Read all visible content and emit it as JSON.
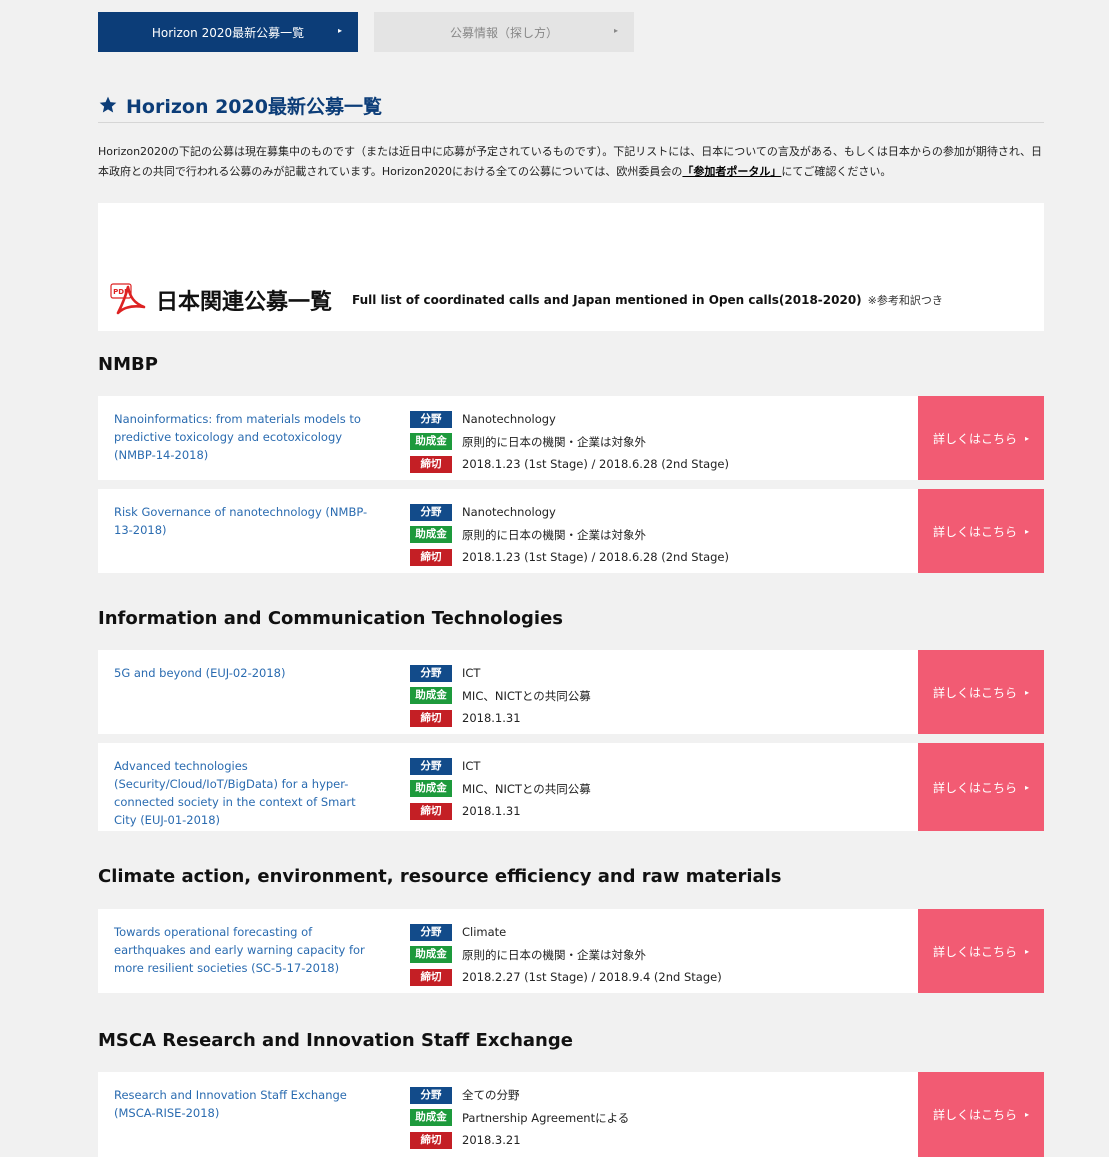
{
  "tabs": [
    {
      "label": "Horizon 2020最新公募一覧",
      "arrow": "▸"
    },
    {
      "label": "公募情報（探し方）",
      "arrow": "▸"
    }
  ],
  "page": {
    "title": "Horizon 2020最新公募一覧",
    "intro_pre": "Horizon2020の下記の公募は現在募集中のものです（または近日中に応募が予定されているものです）。下記リストには、日本についての言及がある、もしくは日本からの参加が期待され、日本政府との共同で行われる公募のみが記載されています。Horizon2020における全ての公募については、欧州委員会の",
    "intro_link": "「参加者ポータル」",
    "intro_post": "にてご確認ください。"
  },
  "pdf": {
    "title": "日本関連公募一覧",
    "subtitle": "Full list of coordinated calls and Japan mentioned in Open calls(2018-2020)",
    "note": "※参考和訳つき"
  },
  "labels": {
    "field": "分野",
    "grant": "助成金",
    "deadline": "締切",
    "detail": "詳しくはこちら",
    "detail_arrow": "▸"
  },
  "sections": [
    {
      "title": "NMBP",
      "calls": [
        {
          "title": "Nanoinformatics: from materials models to predictive toxicology and ecotoxicology (NMBP-14-2018)",
          "field": "Nanotechnology",
          "grant": "原則的に日本の機関・企業は対象外",
          "deadline": "2018.1.23 (1st Stage) / 2018.6.28 (2nd Stage)"
        },
        {
          "title": "Risk Governance of nanotechnology (NMBP-13-2018)",
          "field": "Nanotechnology",
          "grant": "原則的に日本の機関・企業は対象外",
          "deadline": "2018.1.23 (1st Stage) / 2018.6.28 (2nd Stage)"
        }
      ]
    },
    {
      "title": "Information and Communication Technologies",
      "calls": [
        {
          "title": "5G and beyond (EUJ-02-2018)",
          "field": "ICT",
          "grant": "MIC、NICTとの共同公募",
          "deadline": "2018.1.31"
        },
        {
          "title": "Advanced technologies (Security/Cloud/IoT/BigData) for a hyper-connected society in the context of Smart City (EUJ-01-2018)",
          "field": "ICT",
          "grant": "MIC、NICTとの共同公募",
          "deadline": "2018.1.31"
        }
      ]
    },
    {
      "title": "Climate action, environment, resource efficiency and raw materials",
      "calls": [
        {
          "title": "Towards operational forecasting of earthquakes and early warning capacity for more resilient societies (SC-5-17-2018)",
          "field": "Climate",
          "grant": "原則的に日本の機関・企業は対象外",
          "deadline": "2018.2.27 (1st Stage) / 2018.9.4 (2nd Stage)"
        }
      ]
    },
    {
      "title": "MSCA Research and Innovation Staff Exchange",
      "calls": [
        {
          "title": "Research and Innovation Staff Exchange (MSCA-RISE-2018)",
          "field": "全ての分野",
          "grant": "Partnership Agreementによる",
          "deadline": "2018.3.21"
        }
      ]
    }
  ],
  "colors": {
    "navy": "#0c3d78",
    "field_badge": "#124b8a",
    "grant_badge": "#1d9a3c",
    "deadline_badge": "#c41f25",
    "detail_button": "#f25b73",
    "link": "#2a6bb0"
  }
}
